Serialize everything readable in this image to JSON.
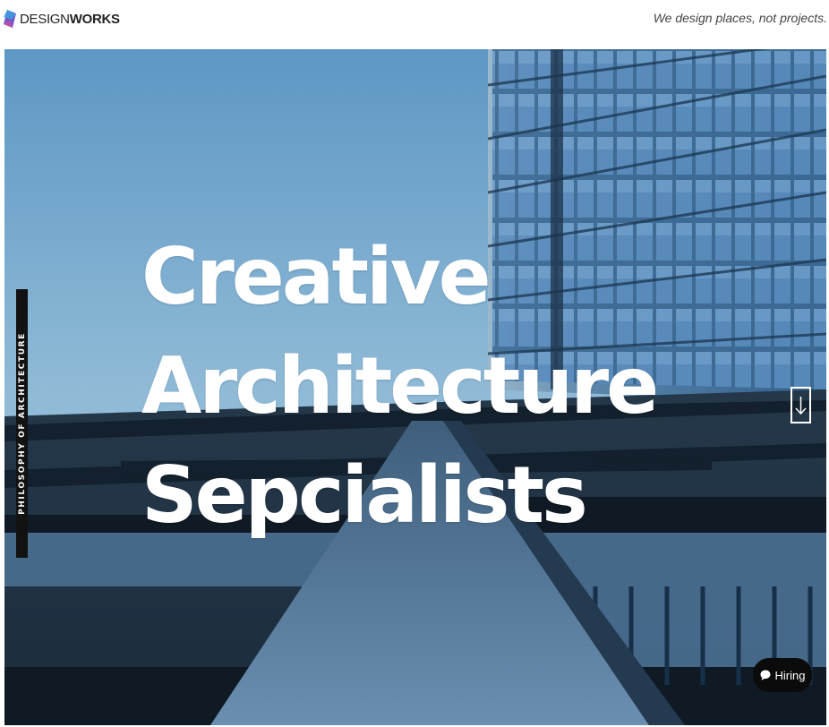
{
  "header": {
    "logo_text_a": "DESIGN",
    "logo_text_b": "WORKS",
    "tagline": "We design places, not projects."
  },
  "hero": {
    "side_label": "PHILOSOPHY OF ARCHITECTURE",
    "headline_lines": [
      "Creative",
      "Architecture",
      "Sepcialists"
    ],
    "scroll_icon": "arrow-down-icon"
  },
  "chat": {
    "label": "Hiring",
    "icon": "chat-bubble-icon"
  },
  "colors": {
    "hero_sky": "#8fbcd8",
    "hero_building": "#2b4d6b",
    "text_on_hero": "#ffffff",
    "chat_bg": "#0b0b0b"
  }
}
